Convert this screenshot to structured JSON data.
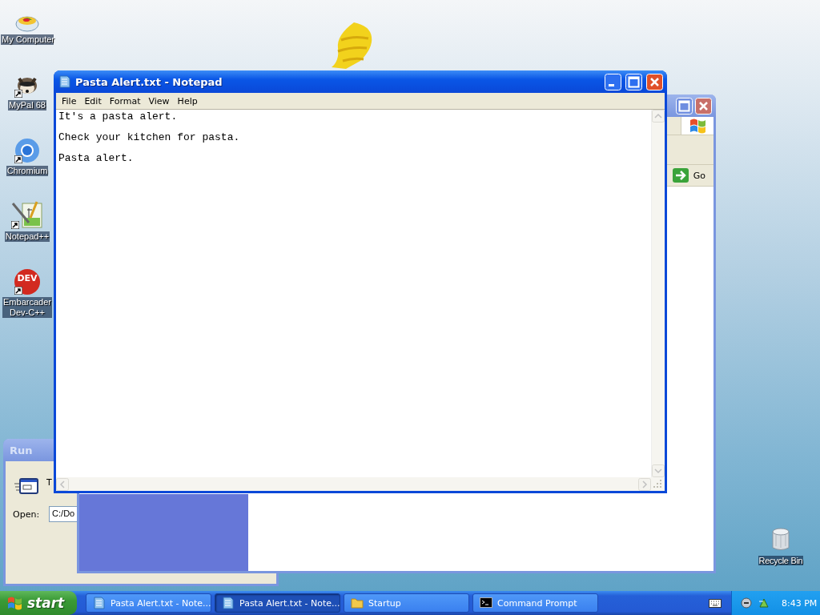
{
  "desktop_icons": [
    {
      "kind": "bowl",
      "label": "My Computer",
      "shortcut": false
    },
    {
      "kind": "raccoon",
      "label": "MyPal 68",
      "shortcut": true
    },
    {
      "kind": "chromium",
      "label": "Chromium",
      "shortcut": true
    },
    {
      "kind": "notepadpp",
      "label": "Notepad++",
      "shortcut": true
    },
    {
      "kind": "devcpp",
      "label": "Embarcader\nDev-C++",
      "shortcut": true,
      "logo_text": "DEV"
    }
  ],
  "recycle_bin": {
    "label": "Recycle Bin"
  },
  "run_dialog": {
    "title": "Run",
    "description_lines": [
      "T"
    ],
    "open_label": "Open:",
    "open_value": "C:/Do"
  },
  "browser_window": {
    "go_button": "Go"
  },
  "notepad": {
    "title": "Pasta Alert.txt - Notepad",
    "menu": [
      "File",
      "Edit",
      "Format",
      "View",
      "Help"
    ],
    "lines": [
      "It's a pasta alert.",
      "Check your kitchen for pasta.",
      "Pasta alert."
    ]
  },
  "taskbar": {
    "start": "start",
    "tasks": [
      {
        "kind": "notepad",
        "label": "Pasta Alert.txt - Note...",
        "selected": false
      },
      {
        "kind": "notepad",
        "label": "Pasta Alert.txt - Note...",
        "selected": true
      },
      {
        "kind": "folder",
        "label": "Startup",
        "selected": false
      },
      {
        "kind": "console",
        "label": "Command Prompt",
        "selected": false
      }
    ],
    "clock": "8:43 PM"
  }
}
